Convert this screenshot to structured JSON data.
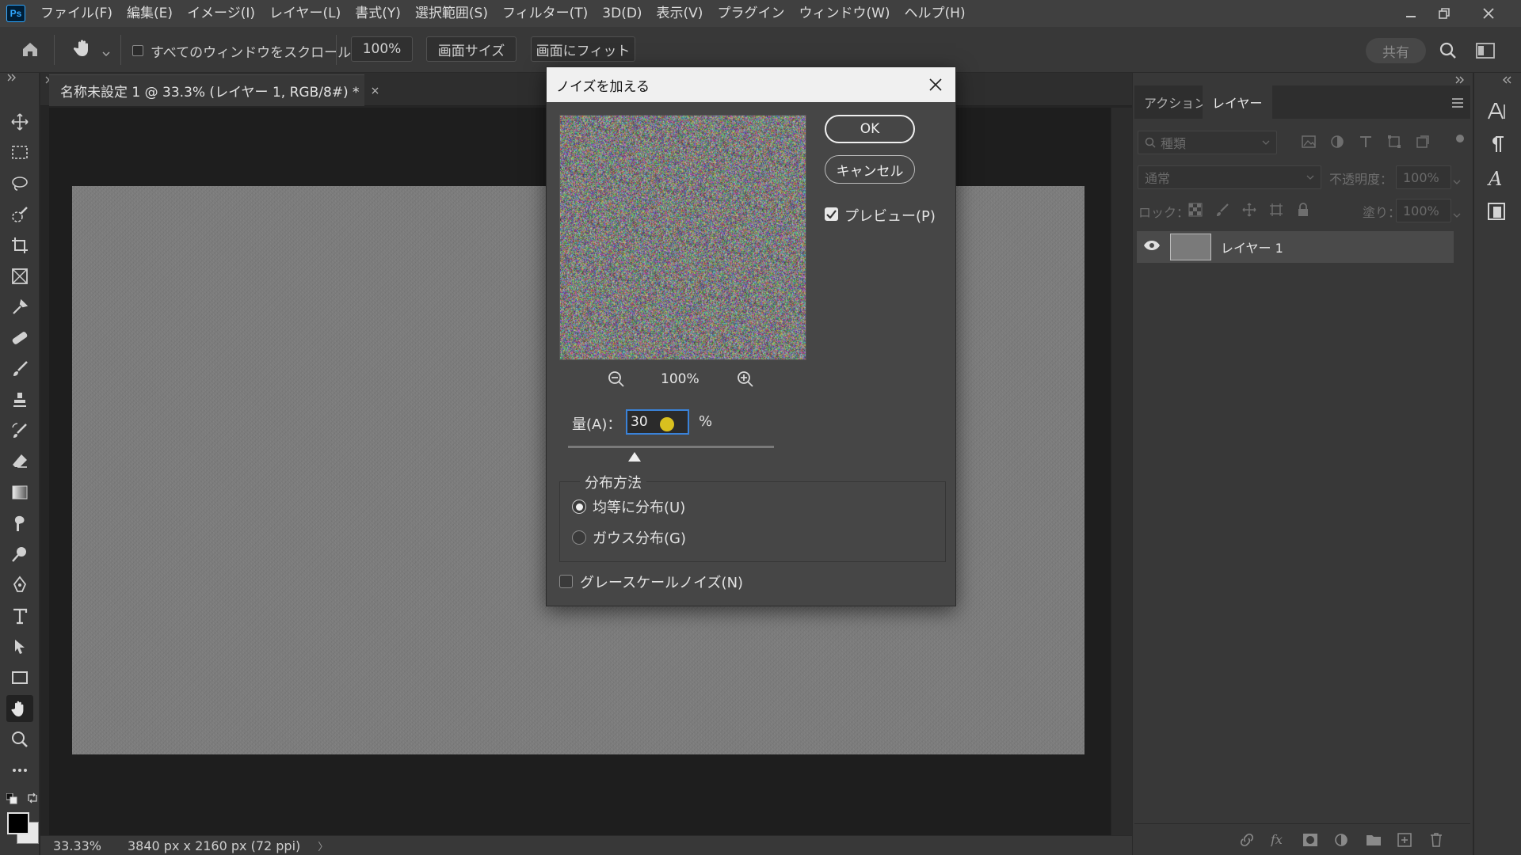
{
  "app": {
    "logo": "Ps",
    "menu": [
      "ファイル(F)",
      "編集(E)",
      "イメージ(I)",
      "レイヤー(L)",
      "書式(Y)",
      "選択範囲(S)",
      "フィルター(T)",
      "3D(D)",
      "表示(V)",
      "プラグイン",
      "ウィンドウ(W)",
      "ヘルプ(H)"
    ]
  },
  "options_bar": {
    "scroll_all_label": "すべてのウィンドウをスクロール",
    "zoom_value": "100%",
    "screen_size_label": "画面サイズ",
    "fit_screen_label": "画面にフィット",
    "share_label": "共有"
  },
  "document": {
    "tab_title": "名称未設定 1 @ 33.3% (レイヤー 1, RGB/8#) *",
    "close_glyph": "×"
  },
  "status_bar": {
    "zoom": "33.33%",
    "dimensions": "3840 px x 2160 px (72 ppi)",
    "arrow": "〉"
  },
  "layers_panel": {
    "tabs": [
      "アクション",
      "レイヤー"
    ],
    "active_tab": "レイヤー",
    "search_placeholder": "種類",
    "blend_mode": "通常",
    "opacity_label": "不透明度：",
    "opacity_value": "100%",
    "lock_label": "ロック：",
    "fill_label": "塗り：",
    "fill_value": "100%",
    "layers": [
      {
        "name": "レイヤー 1",
        "visible": true
      }
    ]
  },
  "dialog": {
    "title": "ノイズを加える",
    "ok_label": "OK",
    "cancel_label": "キャンセル",
    "preview_label": "プレビュー(P)",
    "preview_checked": true,
    "zoom_value": "100%",
    "amount_label": "量(A)：",
    "amount_value": "30",
    "amount_unit": "%",
    "distribution_legend": "分布方法",
    "distribution_options": [
      "均等に分布(U)",
      "ガウス分布(G)"
    ],
    "distribution_selected": 0,
    "grayscale_label": "グレースケールノイズ(N)",
    "grayscale_checked": false
  },
  "colors": {
    "accent": "#3a82d8",
    "cursor": "#ecd01e"
  }
}
